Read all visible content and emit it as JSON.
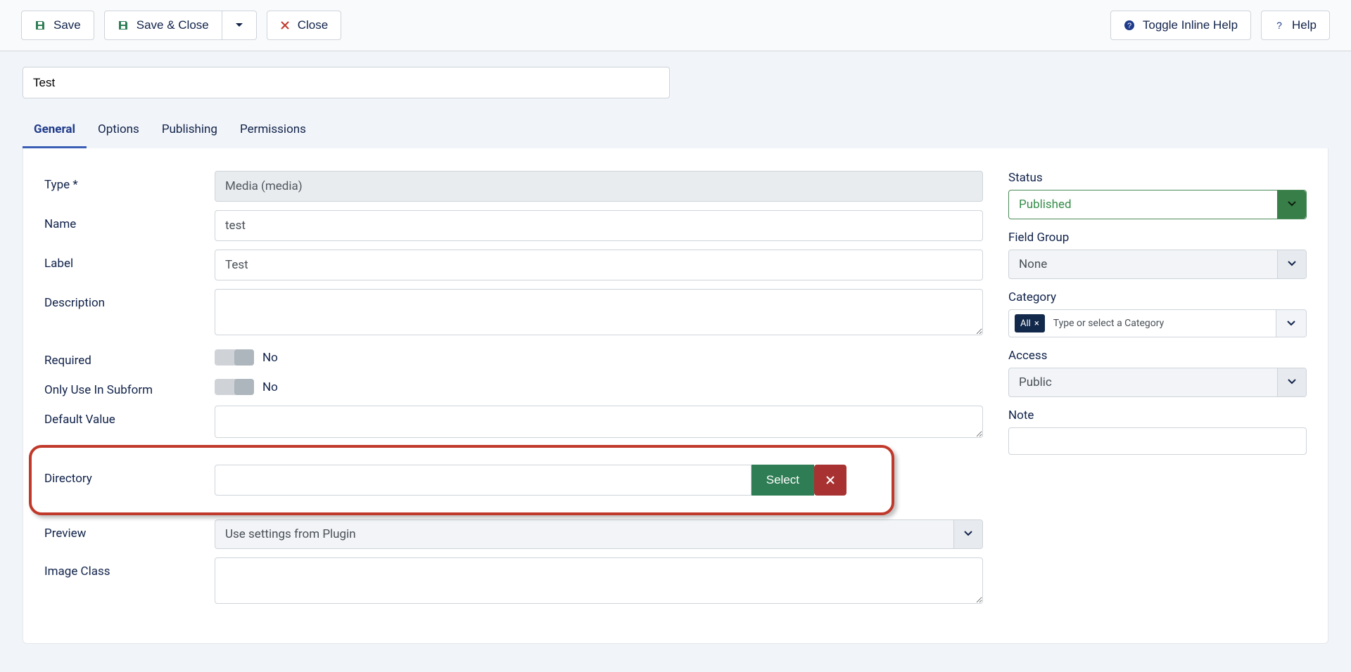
{
  "toolbar": {
    "save": "Save",
    "save_close": "Save & Close",
    "close": "Close",
    "toggle_help": "Toggle Inline Help",
    "help": "Help"
  },
  "title_value": "Test",
  "tabs": {
    "general": "General",
    "options": "Options",
    "publishing": "Publishing",
    "permissions": "Permissions"
  },
  "fields": {
    "type": {
      "label": "Type *",
      "value": "Media (media)"
    },
    "name": {
      "label": "Name",
      "value": "test"
    },
    "label_f": {
      "label": "Label",
      "value": "Test"
    },
    "description": {
      "label": "Description",
      "value": ""
    },
    "required": {
      "label": "Required",
      "value": "No"
    },
    "subform": {
      "label": "Only Use In Subform",
      "value": "No"
    },
    "default": {
      "label": "Default Value",
      "value": ""
    },
    "directory": {
      "label": "Directory",
      "value": "",
      "select": "Select"
    },
    "preview": {
      "label": "Preview",
      "value": "Use settings from Plugin"
    },
    "image_class": {
      "label": "Image Class",
      "value": ""
    }
  },
  "sidebar": {
    "status": {
      "label": "Status",
      "value": "Published"
    },
    "field_group": {
      "label": "Field Group",
      "value": "None"
    },
    "category": {
      "label": "Category",
      "chip": "All",
      "placeholder": "Type or select a Category"
    },
    "access": {
      "label": "Access",
      "value": "Public"
    },
    "note": {
      "label": "Note",
      "value": ""
    }
  }
}
